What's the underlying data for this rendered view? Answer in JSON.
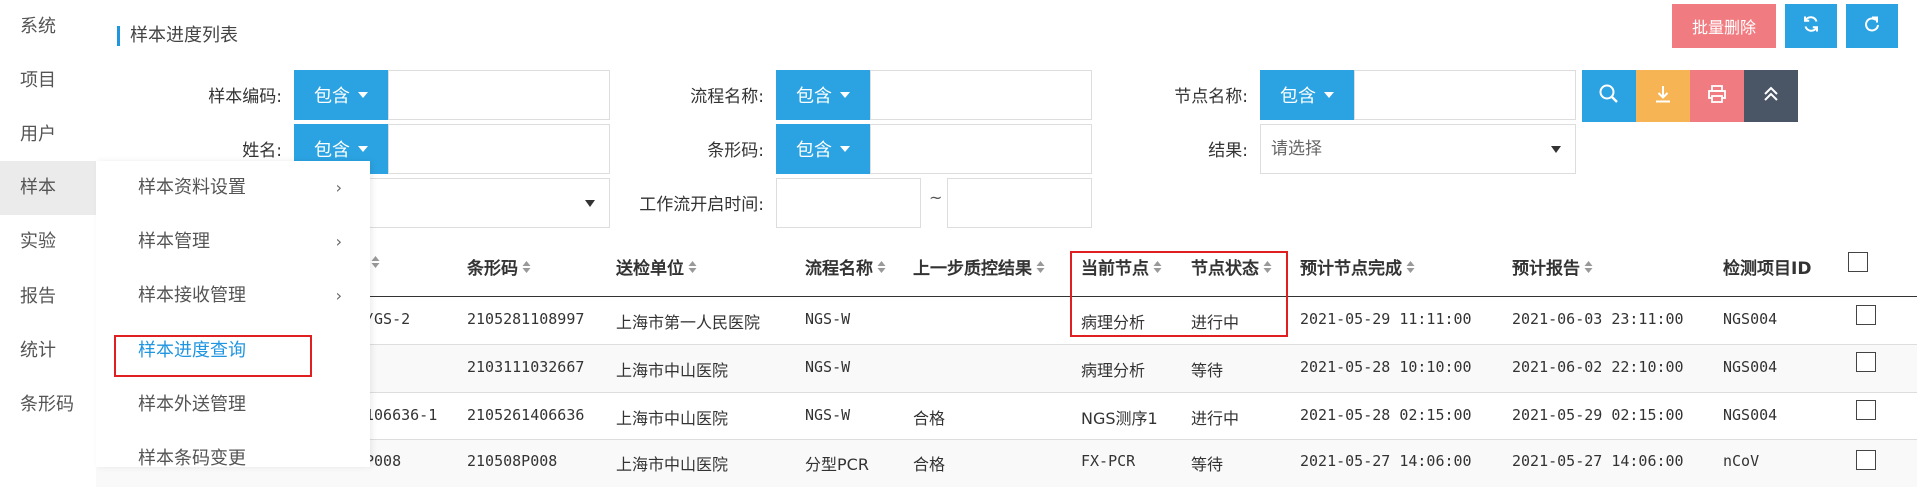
{
  "left_nav": [
    "系统",
    "项目",
    "用户",
    "样本",
    "实验",
    "报告",
    "统计",
    "条形码"
  ],
  "sub_menu": [
    {
      "label": "样本资料设置",
      "arrow": "›"
    },
    {
      "label": "样本管理",
      "arrow": "›"
    },
    {
      "label": "样本接收管理",
      "arrow": "›"
    },
    {
      "label": "样本进度查询",
      "arrow": ""
    },
    {
      "label": "样本外送管理",
      "arrow": ""
    },
    {
      "label": "样本条码变更",
      "arrow": ""
    }
  ],
  "page_title": "样本进度列表",
  "toolbar": {
    "batch_delete": "批量删除",
    "refresh_icon": "refresh-icon",
    "redo_icon": "redo-icon"
  },
  "filters": {
    "sample_code": {
      "label": "样本编码:",
      "mode": "包含"
    },
    "flow_name": {
      "label": "流程名称:",
      "mode": "包含"
    },
    "node_name": {
      "label": "节点名称:",
      "mode": "包含"
    },
    "name": {
      "label": "姓名:",
      "mode": "包含"
    },
    "barcode": {
      "label": "条形码:",
      "mode": "包含"
    },
    "result": {
      "label": "结果:",
      "placeholder": "请选择"
    },
    "workflow_start": {
      "label": "工作流开启时间:",
      "sep": "~"
    }
  },
  "actions": {
    "search": "search-icon",
    "export": "download-icon",
    "print": "print-icon",
    "collapse": "collapse-icon"
  },
  "table": {
    "headers": {
      "barcode": "条形码",
      "unit": "送检单位",
      "flow": "流程名称",
      "prev_qc": "上一步质控结果",
      "cur_node": "当前节点",
      "node_status": "节点状态",
      "expect_node": "预计节点完成",
      "expect_report": "预计报告",
      "test_item": "检测项目ID"
    },
    "rows": [
      {
        "code": "/GS-2",
        "barcode": "2105281108997",
        "unit": "上海市第一人民医院",
        "flow": "NGS-W",
        "prev_qc": "",
        "cur_node": "病理分析",
        "node_status": "进行中",
        "expect_node": "2021-05-29 11:11:00",
        "expect_report": "2021-06-03 23:11:00",
        "test_item": "NGS004"
      },
      {
        "code": "",
        "barcode": "2103111032667",
        "unit": "上海市中山医院",
        "flow": "NGS-W",
        "prev_qc": "",
        "cur_node": "病理分析",
        "node_status": "等待",
        "expect_node": "2021-05-28 10:10:00",
        "expect_report": "2021-06-02 22:10:00",
        "test_item": "NGS004"
      },
      {
        "code": "106636-1",
        "barcode": "2105261406636",
        "unit": "上海市中山医院",
        "flow": "NGS-W",
        "prev_qc": "合格",
        "cur_node": "NGS测序1",
        "node_status": "进行中",
        "expect_node": "2021-05-28 02:15:00",
        "expect_report": "2021-05-29 02:15:00",
        "test_item": "NGS004"
      },
      {
        "code": "P008",
        "barcode": "210508P008",
        "unit": "上海市中山医院",
        "flow": "分型PCR",
        "prev_qc": "合格",
        "cur_node": "FX-PCR",
        "node_status": "等待",
        "expect_node": "2021-05-27 14:06:00",
        "expect_report": "2021-05-27 14:06:00",
        "test_item": "nCoV"
      }
    ]
  },
  "colors": {
    "accent": "#2ba3e2",
    "danger": "#f07c82",
    "warning": "#f7b455",
    "dark": "#4a5566",
    "highlight": "#e02020"
  }
}
